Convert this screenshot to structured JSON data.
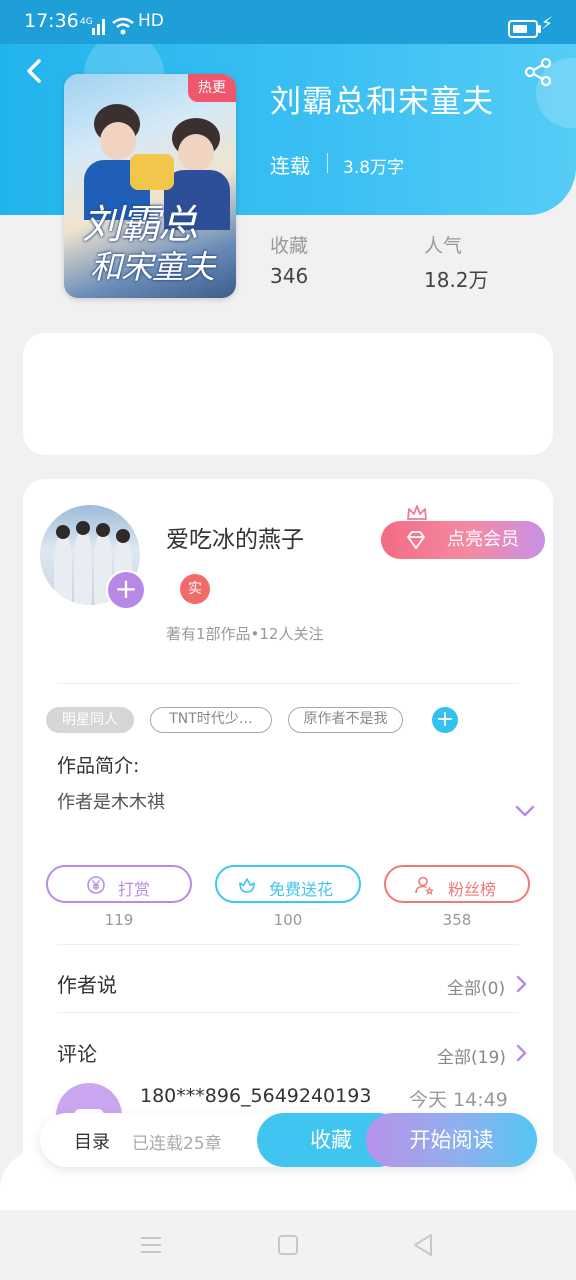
{
  "status_bar": {
    "time": "17:36",
    "network": "4G",
    "hd": "HD"
  },
  "book": {
    "title": "刘霸总和宋童夫",
    "status": "连载",
    "word_count": "3.8万字",
    "cover_badge": "热更",
    "cover_title_line1": "刘霸总",
    "cover_title_line2": "和宋童夫",
    "stats": [
      {
        "label": "收藏",
        "value": "346"
      },
      {
        "label": "人气",
        "value": "18.2万"
      }
    ]
  },
  "author": {
    "name": "爱吃冰的燕子",
    "verified_badge": "实",
    "meta": "著有1部作品•12人关注",
    "vip_button": "点亮会员"
  },
  "tags": [
    "明星同人",
    "TNT时代少…",
    "原作者不是我"
  ],
  "intro": {
    "label": "作品简介:",
    "text": "作者是木木祺"
  },
  "actions": [
    {
      "label": "打赏",
      "count": "119",
      "color": "#b98be8"
    },
    {
      "label": "免费送花",
      "count": "100",
      "color": "#3fc6ee"
    },
    {
      "label": "粉丝榜",
      "count": "358",
      "color": "#f07a76"
    }
  ],
  "author_says": {
    "title": "作者说",
    "link": "全部(0)"
  },
  "comments": {
    "title": "评论",
    "link": "全部(19)",
    "first": {
      "user": "180***896_5649240193",
      "time": "今天  14:49"
    }
  },
  "bottom_bar": {
    "toc": "目录",
    "chapters": "已连载25章",
    "favorite": "收藏",
    "read": "开始阅读"
  },
  "icons": [
    "back-arrow-icon",
    "share-icon",
    "diamond-icon",
    "crown-icon",
    "plus-icon",
    "yen-coin-icon",
    "flower-icon",
    "fans-rank-icon",
    "chevron-down-icon",
    "chevron-right-icon",
    "menu-icon",
    "home-icon",
    "back-triangle-icon"
  ]
}
